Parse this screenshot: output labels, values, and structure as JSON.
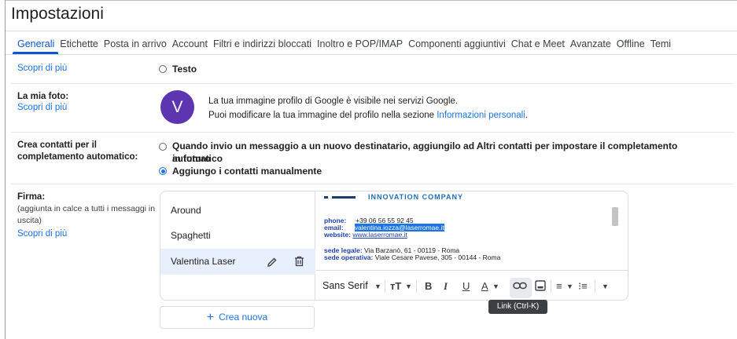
{
  "page": {
    "title": "Impostazioni"
  },
  "tabs": [
    {
      "label": "Generali",
      "active": true
    },
    {
      "label": "Etichette"
    },
    {
      "label": "Posta in arrivo"
    },
    {
      "label": "Account"
    },
    {
      "label": "Filtri e indirizzi bloccati"
    },
    {
      "label": "Inoltro e POP/IMAP"
    },
    {
      "label": "Componenti aggiuntivi"
    },
    {
      "label": "Chat e Meet"
    },
    {
      "label": "Avanzate"
    },
    {
      "label": "Offline"
    },
    {
      "label": "Temi"
    }
  ],
  "buttons_section": {
    "learn_more": "Scopri di più",
    "option_text": "Testo"
  },
  "photo_section": {
    "label": "La mia foto:",
    "learn_more": "Scopri di più",
    "avatar_letter": "V",
    "line1": "La tua immagine profilo di Google è visibile nei servizi Google.",
    "line2_prefix": "Puoi modificare la tua immagine del profilo nella sezione",
    "line2_link": "Informazioni personali",
    "line2_suffix": "."
  },
  "contacts_section": {
    "label_line1": "Crea contatti per il",
    "label_line2": "completamento automatico:",
    "option1_line1": "Quando invio un messaggio a un nuovo destinatario, aggiungilo ad Altri contatti per impostare il completamento automatico",
    "option1_line2": "in futuro",
    "option2": "Aggiungo i contatti manualmente",
    "selected": "option2"
  },
  "signature_section": {
    "label": "Firma:",
    "sub_line1": "(aggiunta in calce a tutti i messaggi in",
    "sub_line2": "uscita)",
    "learn_more": "Scopri di più",
    "signatures": [
      "Around",
      "Spaghetti",
      "Valentina Laser"
    ],
    "selected_signature": "Valentina Laser",
    "create_new": "Crea nuova",
    "preview": {
      "company": "INNOVATION COMPANY",
      "phone_label": "phone:",
      "phone": "+39 06 56 55 92 45",
      "email_label": "email:",
      "email": "valentina.iozza@laserromae.it",
      "website_label": "website:",
      "website": "www.laserromae.it",
      "legal_label": "sede legale:",
      "legal": "Via Barzanò, 61 - 00119 - Roma",
      "op_label": "sede operativa:",
      "op": "Viale Cesare Pavese, 305 - 00144 - Roma"
    },
    "toolbar": {
      "font": "Sans Serif",
      "tooltip": "Link (Ctrl-K)"
    }
  },
  "colors": {
    "accent": "#0b57d0",
    "link": "#1a73e8",
    "avatar": "#5e35b1",
    "selected_row": "#e8f0fe"
  }
}
